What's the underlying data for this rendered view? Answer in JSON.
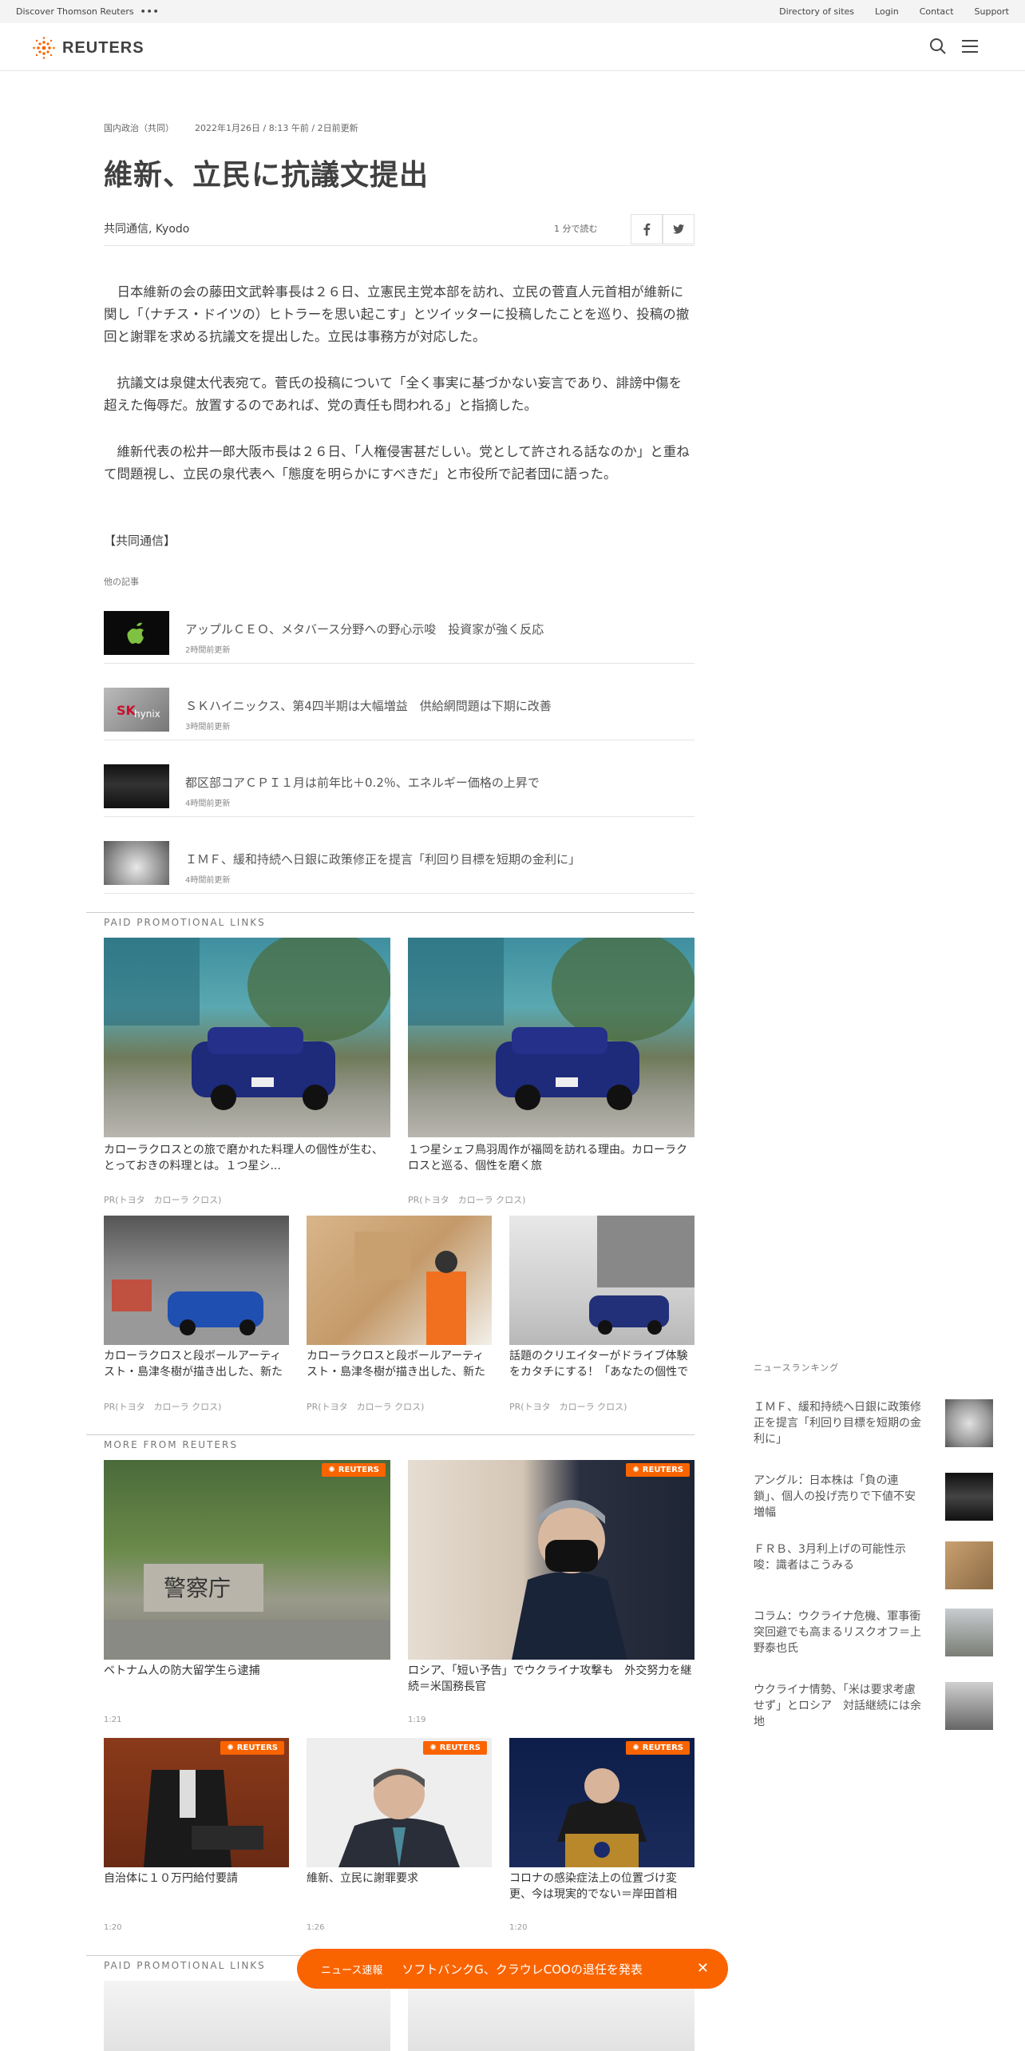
{
  "util": {
    "left": "Discover Thomson Reuters",
    "dots": "•••",
    "links": [
      "Directory of sites",
      "Login",
      "Contact",
      "Support"
    ]
  },
  "brand": "REUTERS",
  "article": {
    "category": "国内政治（共同）",
    "date": "2022年1月26日 / 8:13 午前 / 2日前更新",
    "title": "維新、立民に抗議文提出",
    "author": "共同通信, Kyodo",
    "readtime": "1 分で読む",
    "paragraphs": [
      "　日本維新の会の藤田文武幹事長は２６日、立憲民主党本部を訪れ、立民の菅直人元首相が維新に関し「（ナチス・ドイツの）ヒトラーを思い起こす」とツイッターに投稿したことを巡り、投稿の撤回と謝罪を求める抗議文を提出した。立民は事務方が対応した。",
      "　抗議文は泉健太代表宛て。菅氏の投稿について「全く事実に基づかない妄言であり、誹謗中傷を超えた侮辱だ。放置するのであれば、党の責任も問われる」と指摘した。",
      "　維新代表の松井一郎大阪市長は２６日、「人権侵害甚だしい。党として許される話なのか」と重ねて問題視し、立民の泉代表へ「態度を明らかにすべきだ」と市役所で記者団に語った。"
    ],
    "source": "【共同通信】"
  },
  "others": {
    "heading": "他の記事",
    "items": [
      {
        "title": "アップルＣＥＯ、メタバース分野への野心示唆　投資家が強く反応",
        "time": "2時間前更新"
      },
      {
        "title": "ＳＫハイニックス、第4四半期は大幅増益　供給網問題は下期に改善",
        "time": "3時間前更新"
      },
      {
        "title": "都区部コアＣＰＩ１月は前年比＋0.2％、エネルギー価格の上昇で",
        "time": "4時間前更新"
      },
      {
        "title": "ＩＭＦ、緩和持続へ日銀に政策修正を提言「利回り目標を短期の金利に」",
        "time": "4時間前更新"
      }
    ]
  },
  "promo": {
    "heading": "PAID PROMOTIONAL LINKS",
    "big": [
      {
        "text": "カローラクロスとの旅で磨かれた料理人の個性が生む、とっておきの料理とは。１つ星シ...",
        "src": "PR(トヨタ　カローラ クロス)"
      },
      {
        "text": "１つ星シェフ鳥羽周作が福岡を訪れる理由。カローラクロスと巡る、個性を磨く旅",
        "src": "PR(トヨタ　カローラ クロス)"
      }
    ],
    "small": [
      {
        "text": "カローラクロスと段ボールアーティスト・島津冬樹が描き出した、新たな個性、新たな",
        "src": "PR(トヨタ　カローラ クロス)"
      },
      {
        "text": "カローラクロスと段ボールアーティスト・島津冬樹が描き出した、新たな個性、新たな",
        "src": "PR(トヨタ　カローラ クロス)"
      },
      {
        "text": "話題のクリエイターがドライブ体験をカタチにする！「あなたの個性で完成する",
        "src": "PR(トヨタ　カローラ クロス)"
      }
    ]
  },
  "more": {
    "heading": "MORE FROM REUTERS",
    "badge": "REUTERS",
    "big": [
      {
        "text": "ベトナム人の防大留学生ら逮捕",
        "time": "1:21"
      },
      {
        "text": "ロシア、「短い予告」でウクライナ攻撃も　外交努力を継続＝米国務長官",
        "time": "1:19"
      }
    ],
    "small": [
      {
        "text": "自治体に１０万円給付要請",
        "time": "1:20"
      },
      {
        "text": "維新、立民に謝罪要求",
        "time": "1:26"
      },
      {
        "text": "コロナの感染症法上の位置づけ変更、今は現実的でない＝岸田首相",
        "time": "1:20"
      }
    ]
  },
  "promo2_heading": "PAID PROMOTIONAL LINKS",
  "ranking": {
    "heading": "ニュースランキング",
    "items": [
      "ＩＭＦ、緩和持続へ日銀に政策修正を提言「利回り目標を短期の金利に」",
      "アングル：日本株は「負の連鎖」、個人の投げ売りで下値不安増幅",
      "ＦＲＢ、3月利上げの可能性示唆：識者はこうみる",
      "コラム：ウクライナ危機、軍事衝突回避でも高まるリスクオフ＝上野泰也氏",
      "ウクライナ情勢、「米は要求考慮せず」とロシア　対話継続には余地"
    ]
  },
  "breaking": {
    "label": "ニュース速報",
    "text": "ソフトバンクG、クラウレCOOの退任を発表",
    "close": "✕"
  },
  "colors": {
    "accent": "#fa6400",
    "text": "#404040"
  }
}
